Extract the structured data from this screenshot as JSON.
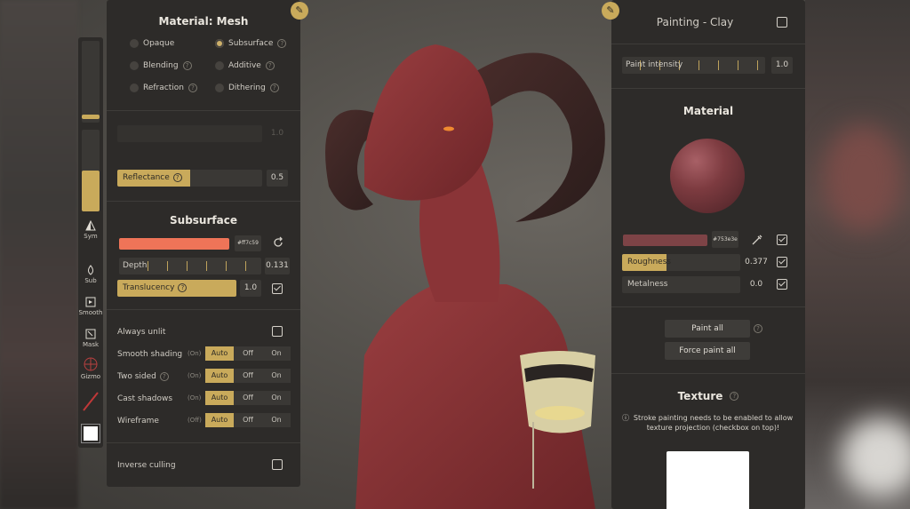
{
  "left_panel": {
    "title": "Material: Mesh",
    "render_modes": [
      {
        "label": "Opaque",
        "selected": false,
        "help": false
      },
      {
        "label": "Subsurface",
        "selected": true,
        "help": true
      },
      {
        "label": "Blending",
        "selected": false,
        "help": true
      },
      {
        "label": "Additive",
        "selected": false,
        "help": true
      },
      {
        "label": "Refraction",
        "selected": false,
        "help": true
      },
      {
        "label": "Dithering",
        "selected": false,
        "help": true
      }
    ],
    "disabled_value": "1.0",
    "reflectance": {
      "label": "Reflectance",
      "value": "0.5",
      "fill": 0.5
    },
    "subsurface": {
      "title": "Subsurface",
      "color_hex": "#ff7c59",
      "color": "#ef7458",
      "depth": {
        "label": "Depth",
        "value": "0.131"
      },
      "translucency": {
        "label": "Translucency",
        "value": "1.0",
        "fill": 1.0
      }
    },
    "always_unlit": "Always unlit",
    "render_options": [
      {
        "label": "Smooth shading",
        "help": false,
        "pre": "(On)",
        "options": [
          "Auto",
          "Off",
          "On"
        ],
        "selected": "Auto"
      },
      {
        "label": "Two sided",
        "help": true,
        "pre": "(On)",
        "options": [
          "Auto",
          "Off",
          "On"
        ],
        "selected": "Auto"
      },
      {
        "label": "Cast shadows",
        "help": false,
        "pre": "(On)",
        "options": [
          "Auto",
          "Off",
          "On"
        ],
        "selected": "Auto"
      },
      {
        "label": "Wireframe",
        "help": false,
        "pre": "(Off)",
        "options": [
          "Auto",
          "Off",
          "On"
        ],
        "selected": "Auto"
      }
    ],
    "inverse_culling": "Inverse culling"
  },
  "right_panel": {
    "title": "Painting - Clay",
    "paint_intensity": {
      "label": "Paint intensity",
      "value": "1.0"
    },
    "material_title": "Material",
    "paint_color_hex": "#753e3e",
    "paint_color": "#7d4346",
    "roughness": {
      "label": "Roughness",
      "value": "0.377",
      "fill": 0.377
    },
    "metalness": {
      "label": "Metalness",
      "value": "0.0",
      "fill": 0
    },
    "paint_all": "Paint all",
    "force_paint_all": "Force paint all",
    "texture_title": "Texture",
    "texture_note": "Stroke painting needs to be enabled to allow texture projection (checkbox on top)!"
  },
  "toolstrip": [
    {
      "label": "Sym",
      "icon": "symmetry-icon"
    },
    {
      "label": "Sub",
      "icon": "subdivide-icon"
    },
    {
      "label": "Smooth",
      "icon": "smooth-icon"
    },
    {
      "label": "Mask",
      "icon": "mask-icon"
    },
    {
      "label": "Gizmo",
      "icon": "gizmo-icon"
    }
  ],
  "colors": {
    "accent": "#c9aa5b",
    "panel": "#2d2b29"
  }
}
